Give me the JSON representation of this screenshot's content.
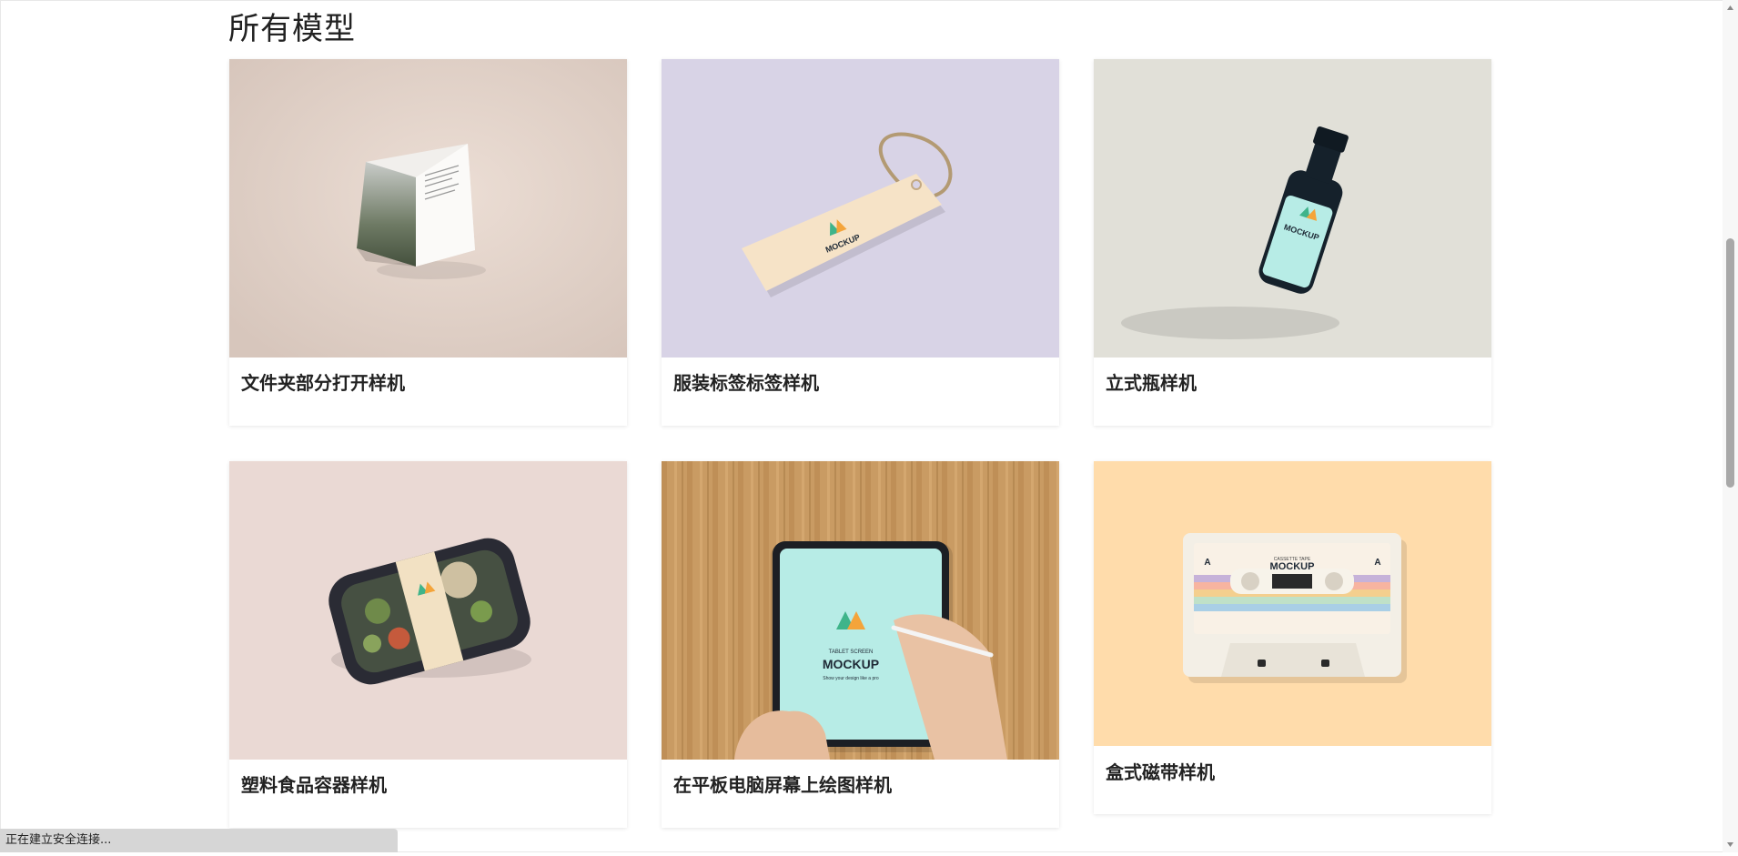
{
  "section": {
    "title": "所有模型"
  },
  "cards": [
    {
      "title": "文件夹部分打开样机",
      "bg": "#e6dbd3"
    },
    {
      "title": "服装标签标签样机",
      "bg": "#d8d3e6"
    },
    {
      "title": "立式瓶样机",
      "bg": "#e1e0d8"
    },
    {
      "title": "塑料食品容器样机",
      "bg": "#ead9d4"
    },
    {
      "title": "在平板电脑屏幕上绘图样机",
      "bg": "#c99b63"
    },
    {
      "title": "盒式磁带样机",
      "bg": "#ffdcab"
    }
  ],
  "mockup_text": {
    "brand": "MOCKUP",
    "tablet_caption": "TABLET SCREEN",
    "tablet_sub": "Show your design like a pro",
    "cassette_caption": "CASSETTE TAPE",
    "cassette_side": "A"
  },
  "status": {
    "text": "正在建立安全连接..."
  },
  "colors": {
    "accent_teal": "#b7ece6",
    "text": "#222222"
  }
}
